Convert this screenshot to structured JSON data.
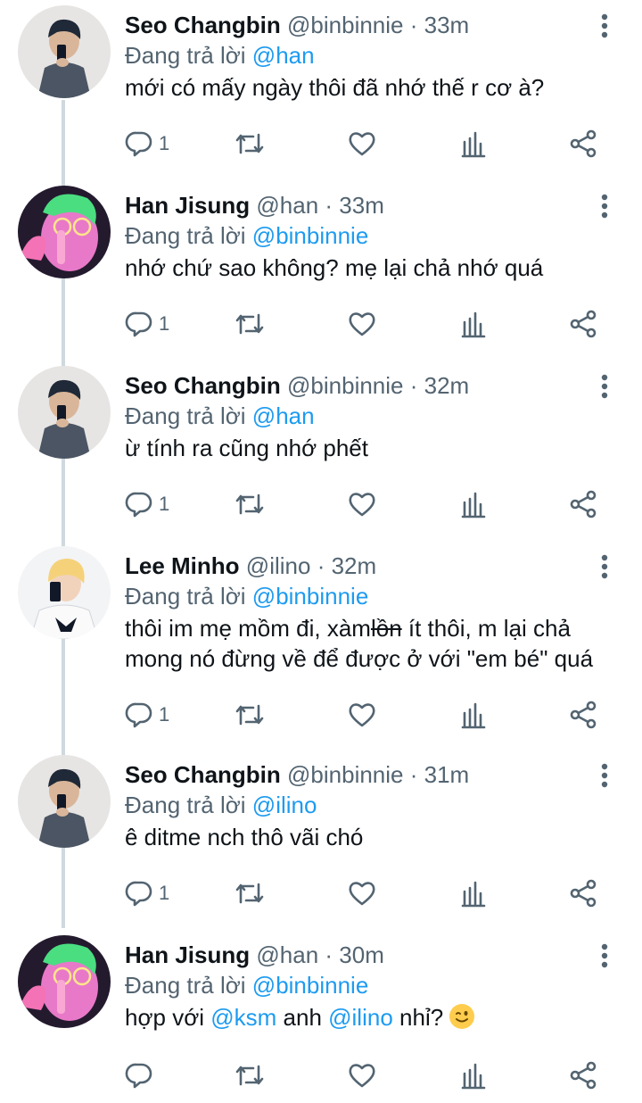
{
  "reply_prefix": "Đang trả lời",
  "tweets": [
    {
      "name": "Seo Changbin",
      "handle": "@binbinnie",
      "time": "33m",
      "reply_to": "@han",
      "text": "mới có mấy ngày thôi đã nhớ thế r cơ à?",
      "reply_count": "1",
      "avatar": "changbin"
    },
    {
      "name": "Han Jisung",
      "handle": "@han",
      "time": "33m",
      "reply_to": "@binbinnie",
      "text": "nhớ chứ sao không? mẹ lại chả nhớ quá",
      "reply_count": "1",
      "avatar": "jisung"
    },
    {
      "name": "Seo Changbin",
      "handle": "@binbinnie",
      "time": "32m",
      "reply_to": "@han",
      "text": "ừ tính ra cũng nhớ phết",
      "reply_count": "1",
      "avatar": "changbin"
    },
    {
      "name": "Lee Minho",
      "handle": "@ilino",
      "time": "32m",
      "reply_to": "@binbinnie",
      "text_parts": [
        "thôi im mẹ mồm đi, xàm",
        "lồn",
        " ít thôi, m lại chả mong nó đừng về để được ở với \"em bé\" quá"
      ],
      "reply_count": "1",
      "avatar": "minho"
    },
    {
      "name": "Seo Changbin",
      "handle": "@binbinnie",
      "time": "31m",
      "reply_to": "@ilino",
      "text": "ê ditme nch thô vãi chó",
      "reply_count": "1",
      "avatar": "changbin"
    },
    {
      "name": "Han Jisung",
      "handle": "@han",
      "time": "30m",
      "reply_to": "@binbinnie",
      "text_parts": [
        "hợp với ",
        "@ksm",
        " anh ",
        "@ilino",
        " nhỉ? "
      ],
      "reply_count": "",
      "avatar": "jisung"
    }
  ],
  "colors": {
    "name": "#0f1419",
    "secondary": "#536471",
    "mention": "#1d9bf0",
    "thread_line": "#cfd9de"
  },
  "icons": [
    "more-vertical-icon",
    "reply-icon",
    "retweet-icon",
    "like-icon",
    "analytics-icon",
    "share-icon",
    "winking-face-emoji"
  ]
}
